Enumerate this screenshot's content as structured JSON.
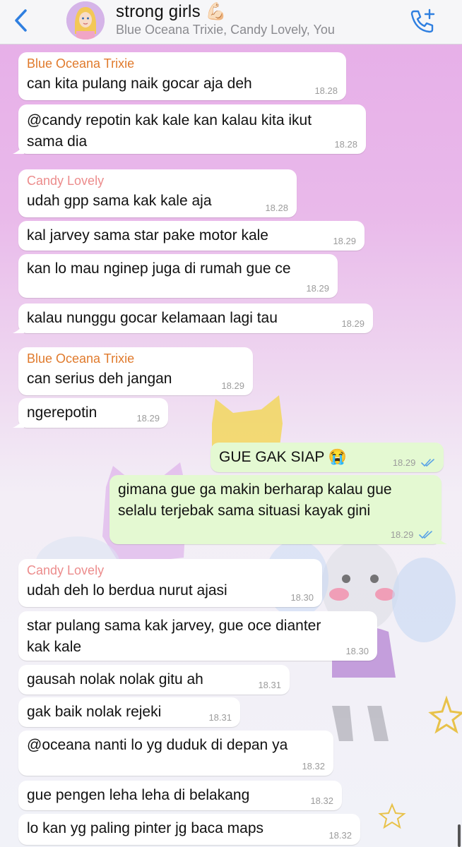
{
  "header": {
    "title": "strong girls",
    "title_emoji": "💪🏻",
    "subtitle": "Blue Oceana Trixie, Candy Lovely, You"
  },
  "messages": [
    {
      "sender": "Blue Oceana Trixie",
      "sender_color": "#e07a2c",
      "text": "can kita pulang naik gocar aja deh",
      "time": "18.28"
    },
    {
      "text": "@candy repotin kak kale kan kalau kita ikut\nsama dia",
      "time": "18.28"
    },
    {
      "sender": "Candy Lovely",
      "sender_color": "#ec8c8c",
      "text": "udah gpp sama kak kale aja",
      "time": "18.28"
    },
    {
      "text": "kal jarvey sama star pake motor kale",
      "time": "18.29"
    },
    {
      "text": "kan lo mau nginep juga di rumah gue ce",
      "time": "18.29"
    },
    {
      "text": "kalau nunggu gocar kelamaan lagi tau",
      "time": "18.29"
    },
    {
      "sender": "Blue Oceana Trixie",
      "sender_color": "#e07a2c",
      "text": "can serius deh jangan",
      "time": "18.29"
    },
    {
      "text": "ngerepotin",
      "time": "18.29"
    },
    {
      "text": "GUE GAK SIAP 😭",
      "time": "18.29"
    },
    {
      "text": "gimana gue ga makin berharap kalau gue\nselalu terjebak sama situasi kayak gini",
      "time": "18.29"
    },
    {
      "sender": "Candy Lovely",
      "sender_color": "#ec8c8c",
      "text": "udah deh lo berdua nurut ajasi",
      "time": "18.30"
    },
    {
      "text": "star pulang sama kak jarvey, gue oce dianter\nkak kale",
      "time": "18.30"
    },
    {
      "text": "gausah nolak nolak gitu ah",
      "time": "18.31"
    },
    {
      "text": "gak baik nolak rejeki",
      "time": "18.31"
    },
    {
      "text": "@oceana nanti lo yg duduk di depan ya",
      "time": "18.32"
    },
    {
      "text": "gue pengen leha leha di belakang",
      "time": "18.32"
    },
    {
      "text": "lo kan yg paling pinter jg baca maps",
      "time": "18.32"
    }
  ],
  "icons": {
    "back": "chevron-left-icon",
    "call": "add-call-icon",
    "read": "double-check-icon"
  },
  "colors": {
    "accent": "#2f7fe0",
    "outgoing_bubble": "#e4f9d2",
    "incoming_bubble": "#ffffff",
    "read_check": "#5aa3e6"
  }
}
